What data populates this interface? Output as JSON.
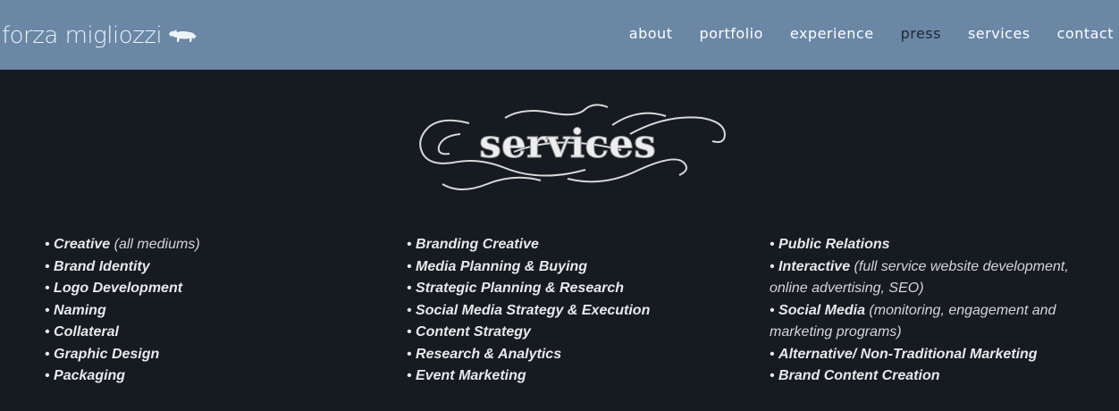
{
  "brand": {
    "name": "forza migliozzi",
    "icon": "bull-icon"
  },
  "nav": {
    "items": [
      {
        "label": "about"
      },
      {
        "label": "portfolio"
      },
      {
        "label": "experience"
      },
      {
        "label": "press",
        "active": true
      },
      {
        "label": "services"
      },
      {
        "label": "contact"
      }
    ]
  },
  "hero": {
    "title": "services"
  },
  "columns": [
    {
      "items": [
        {
          "bold": "Creative",
          "note": " (all mediums)"
        },
        {
          "bold": "Brand Identity"
        },
        {
          "bold": "Logo Development"
        },
        {
          "bold": "Naming"
        },
        {
          "bold": "Collateral"
        },
        {
          "bold": "Graphic Design"
        },
        {
          "bold": "Packaging"
        }
      ]
    },
    {
      "items": [
        {
          "bold": "Branding Creative"
        },
        {
          "bold": "Media Planning & Buying"
        },
        {
          "bold": "Strategic Planning & Research"
        },
        {
          "bold": "Social Media Strategy & Execution"
        },
        {
          "bold": "Content Strategy"
        },
        {
          "bold": "Research & Analytics"
        },
        {
          "bold": "Event Marketing"
        }
      ]
    },
    {
      "items": [
        {
          "bold": "Public Relations"
        },
        {
          "bold": "Interactive",
          "note": " (full service website development, online advertising, SEO)"
        },
        {
          "bold": "Social Media",
          "note": " (monitoring, engagement and marketing programs)"
        },
        {
          "bold": "Alternative/ Non-Traditional Marketing"
        },
        {
          "bold": "Brand Content Creation"
        }
      ]
    }
  ],
  "colors": {
    "header": "#6a87a6",
    "background": "#161a21",
    "text": "#e9e9ea",
    "active_nav": "#1f2733"
  }
}
